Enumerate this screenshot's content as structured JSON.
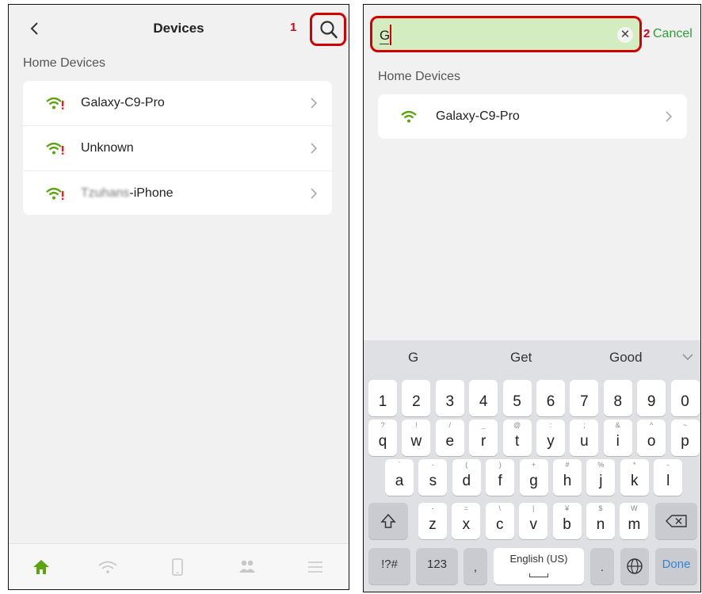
{
  "colors": {
    "accent_green": "#5da412",
    "highlight_red": "#d40000",
    "cancel_green": "#2b9e36",
    "search_fill": "#d3ecc0"
  },
  "left": {
    "title": "Devices",
    "step_number": "1",
    "section_title": "Home Devices",
    "devices": [
      {
        "name": "Galaxy-C9-Pro",
        "icon": "wifi-weak-signal-icon"
      },
      {
        "name": "Unknown",
        "icon": "wifi-weak-signal-icon"
      },
      {
        "name_blurred": "Tzuhans",
        "name_suffix": "-iPhone",
        "icon": "wifi-weak-signal-icon"
      }
    ],
    "tabs": [
      "home-icon",
      "wifi-icon",
      "phone-device-icon",
      "users-icon",
      "menu-icon"
    ]
  },
  "right": {
    "search_value": "G",
    "step_number": "2",
    "cancel_label": "Cancel",
    "section_title": "Home Devices",
    "results": [
      {
        "name": "Galaxy-C9-Pro",
        "icon": "wifi-signal-icon"
      }
    ],
    "keyboard": {
      "suggestions": [
        "G",
        "Get",
        "Good"
      ],
      "numbers": [
        "1",
        "2",
        "3",
        "4",
        "5",
        "6",
        "7",
        "8",
        "9",
        "0"
      ],
      "row1": [
        {
          "k": "q",
          "h": "?"
        },
        {
          "k": "w",
          "h": "!"
        },
        {
          "k": "e",
          "h": "/"
        },
        {
          "k": "r",
          "h": "_"
        },
        {
          "k": "t",
          "h": "@"
        },
        {
          "k": "y",
          "h": ":"
        },
        {
          "k": "u",
          "h": ";"
        },
        {
          "k": "i",
          "h": "&"
        },
        {
          "k": "o",
          "h": "^"
        },
        {
          "k": "p",
          "h": "~"
        }
      ],
      "row2": [
        {
          "k": "a",
          "h": "`"
        },
        {
          "k": "s",
          "h": "-"
        },
        {
          "k": "d",
          "h": "("
        },
        {
          "k": "f",
          "h": ")"
        },
        {
          "k": "g",
          "h": "+"
        },
        {
          "k": "h",
          "h": "#"
        },
        {
          "k": "j",
          "h": "%"
        },
        {
          "k": "k",
          "h": "*"
        },
        {
          "k": "l",
          "h": "-"
        }
      ],
      "row3": [
        {
          "k": "z",
          "h": "-"
        },
        {
          "k": "x",
          "h": "="
        },
        {
          "k": "c",
          "h": "\\"
        },
        {
          "k": "v",
          "h": "|"
        },
        {
          "k": "b",
          "h": "¥"
        },
        {
          "k": "n",
          "h": "$"
        },
        {
          "k": "m",
          "h": "W"
        }
      ],
      "sym_label": "!?#",
      "num_label": "123",
      "comma_label": ",",
      "space_label": "English (US)",
      "period_label": ".",
      "done_label": "Done"
    }
  }
}
